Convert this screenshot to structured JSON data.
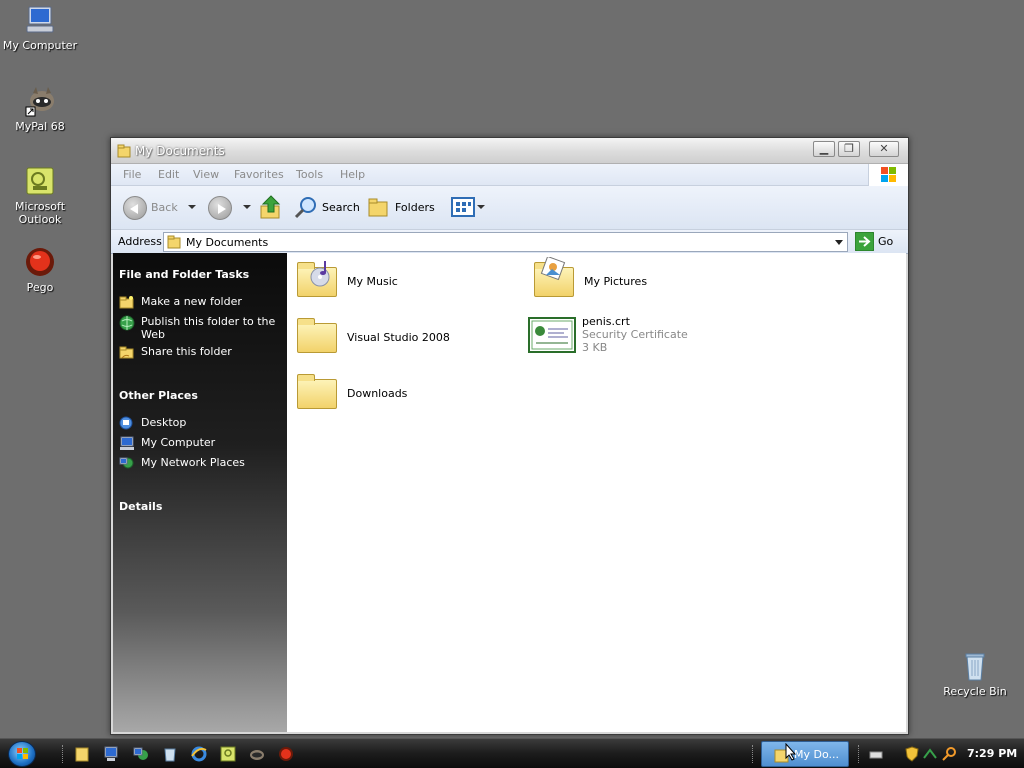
{
  "desktop": {
    "icons": [
      {
        "label": "My Computer"
      },
      {
        "label": "MyPal 68"
      },
      {
        "label": "Microsoft Outlook"
      },
      {
        "label": "Pego"
      },
      {
        "label": "Recycle Bin"
      }
    ]
  },
  "window": {
    "title": "My Documents",
    "menu": [
      "File",
      "Edit",
      "View",
      "Favorites",
      "Tools",
      "Help"
    ],
    "toolbar": {
      "back_label": "Back",
      "search_label": "Search",
      "folders_label": "Folders"
    },
    "address": {
      "label": "Address",
      "value": "My Documents",
      "go_label": "Go"
    },
    "taskpane": {
      "file_folder_tasks": {
        "heading": "File and Folder Tasks",
        "items": [
          "Make a new folder",
          "Publish this folder to the Web",
          "Share this folder"
        ]
      },
      "other_places": {
        "heading": "Other Places",
        "items": [
          "Desktop",
          "My Computer",
          "My Network Places"
        ]
      },
      "details": {
        "heading": "Details"
      }
    },
    "files": [
      {
        "name": "My Music",
        "icon": "music-folder-icon"
      },
      {
        "name": "My Pictures",
        "icon": "pictures-folder-icon"
      },
      {
        "name": "Visual Studio 2008",
        "icon": "folder-icon"
      },
      {
        "name": "penis.crt",
        "type": "Security Certificate",
        "size": "3 KB",
        "icon": "certificate-icon"
      },
      {
        "name": "Downloads",
        "icon": "folder-icon"
      }
    ]
  },
  "taskbar": {
    "active_task": "My Do...",
    "clock": "7:29 PM"
  }
}
